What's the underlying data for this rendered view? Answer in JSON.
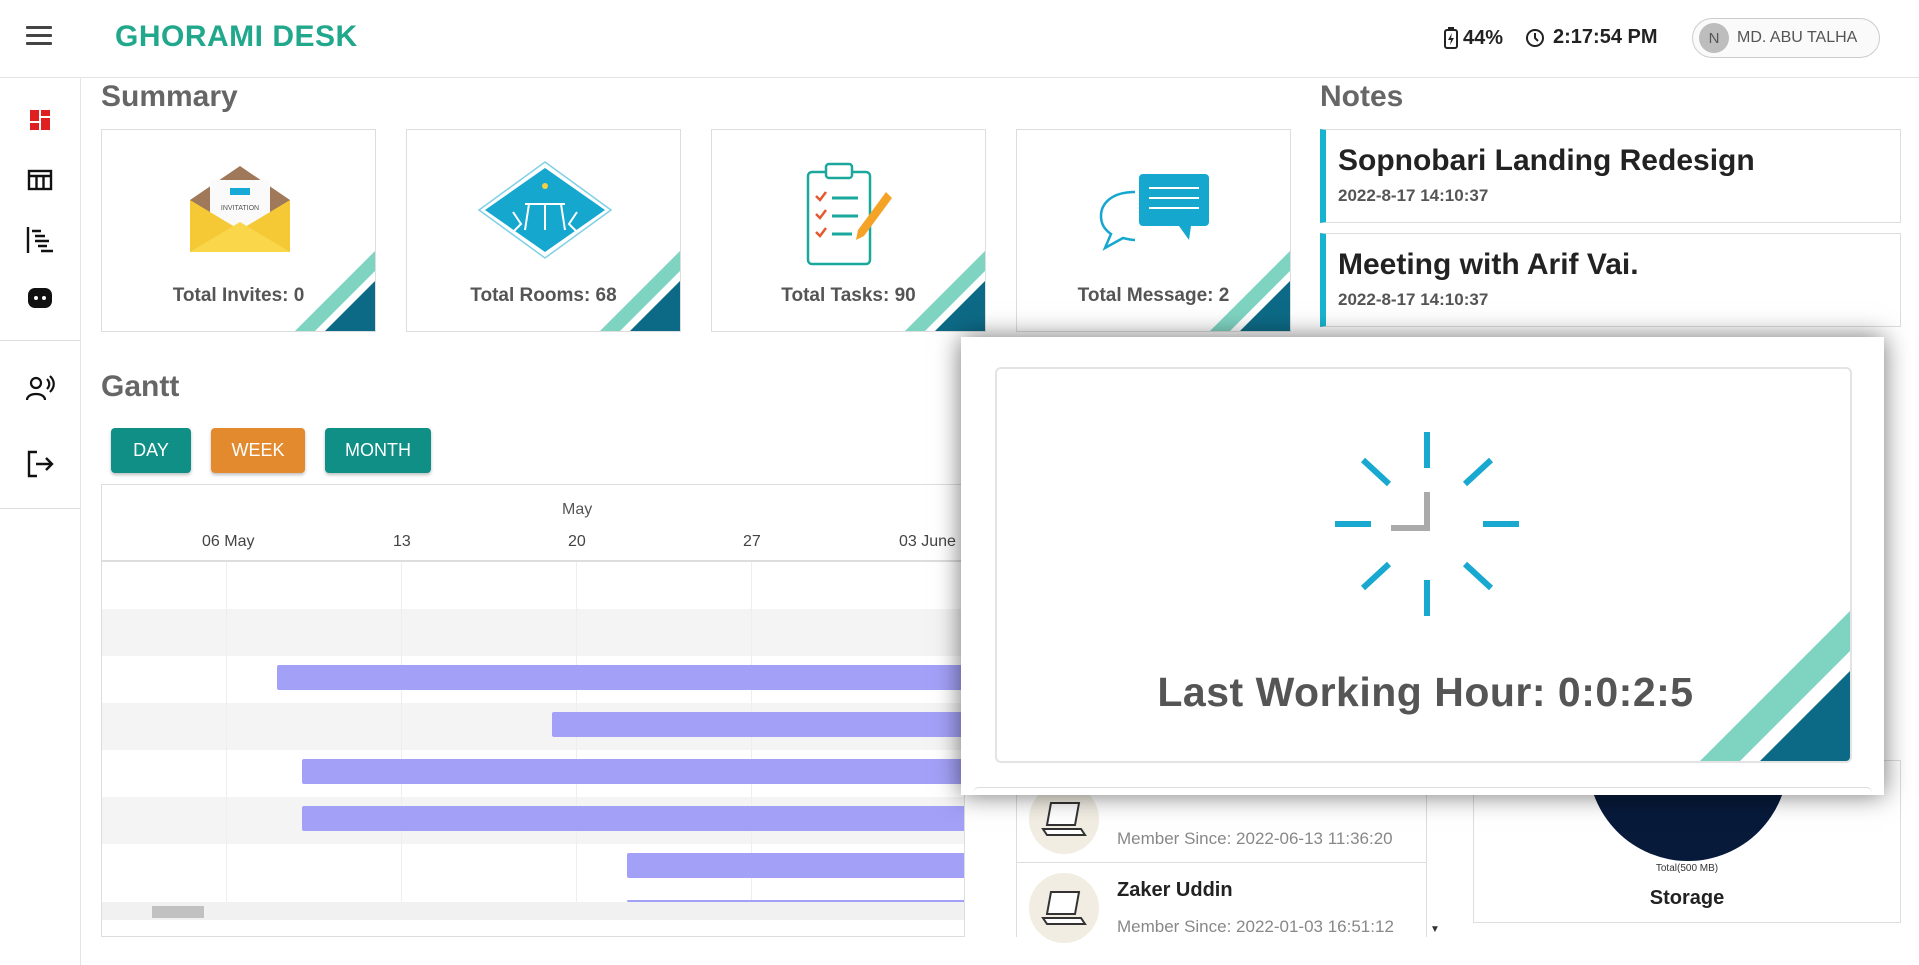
{
  "app": {
    "brand": "GHORAMI DESK"
  },
  "header": {
    "battery": "44%",
    "time": "2:17:54 PM",
    "user_initial": "N",
    "user_name": "MD. ABU TALHA"
  },
  "sidebar": {
    "items": [
      {
        "name": "dashboard",
        "icon": "dashboard-icon",
        "active": true
      },
      {
        "name": "table",
        "icon": "table-icon"
      },
      {
        "name": "gantt",
        "icon": "gantt-list-icon"
      },
      {
        "name": "chat",
        "icon": "chat-bot-icon"
      },
      {
        "name": "members",
        "icon": "person-voice-icon"
      },
      {
        "name": "logout",
        "icon": "logout-icon"
      }
    ]
  },
  "summary": {
    "title": "Summary",
    "cards": [
      {
        "label": "Total Invites: 0",
        "icon": "invitation-envelope-icon"
      },
      {
        "label": "Total Rooms: 68",
        "icon": "meeting-room-icon"
      },
      {
        "label": "Total Tasks: 90",
        "icon": "clipboard-tasks-icon"
      },
      {
        "label": "Total Message: 2",
        "icon": "chat-bubbles-icon"
      }
    ]
  },
  "notes": {
    "title": "Notes",
    "items": [
      {
        "title": "Sopnobari Landing Redesign",
        "date": "2022-8-17 14:10:37"
      },
      {
        "title": "Meeting with Arif Vai.",
        "date": "2022-8-17 14:10:37"
      }
    ]
  },
  "gantt": {
    "title": "Gantt",
    "buttons": [
      {
        "label": "DAY",
        "color": "#0f8f86"
      },
      {
        "label": "WEEK",
        "color": "#e38a2e"
      },
      {
        "label": "MONTH",
        "color": "#0f8f86"
      }
    ],
    "month": "May",
    "ticks": [
      "06 May",
      "13",
      "20",
      "27",
      "03 June"
    ],
    "bar_color": "#a3a1f7"
  },
  "members": [
    {
      "name": "",
      "since": "Member Since: 2022-06-13 11:36:20"
    },
    {
      "name": "Zaker Uddin",
      "since": "Member Since: 2022-01-03 16:51:12"
    }
  ],
  "storage": {
    "label": "Storage",
    "total": "Total(500 MB)"
  },
  "modal": {
    "text": "Last Working Hour: 0:0:2:5"
  },
  "colors": {
    "accent": "#21a88c",
    "note_border": "#18b4cf",
    "teal_light": "#7fd3c1",
    "teal_dark": "#0d6a86",
    "storage_fill": "#071a3a"
  }
}
